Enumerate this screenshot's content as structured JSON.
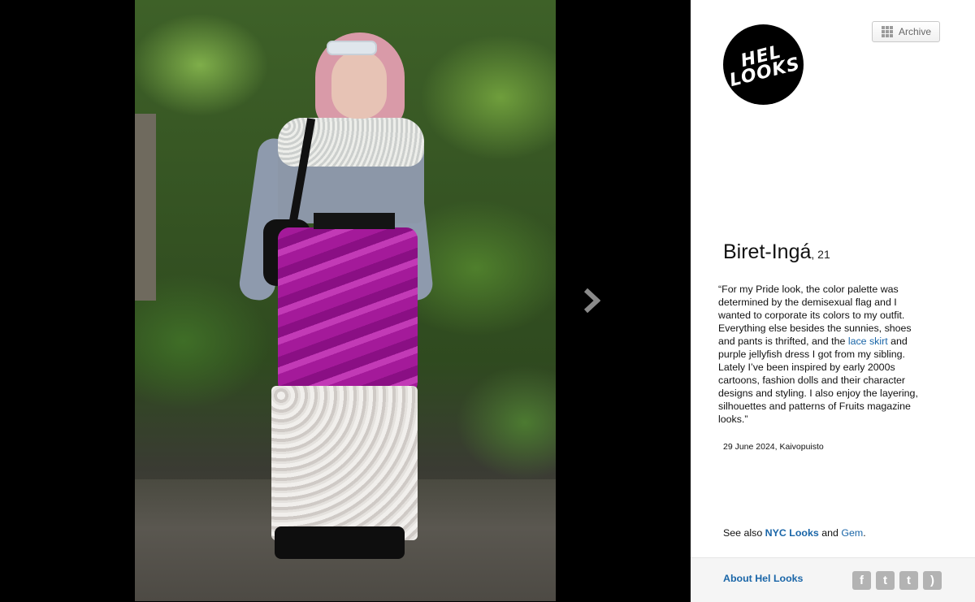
{
  "photo": {
    "alt": ""
  },
  "nav": {
    "next_icon": "chevron-right-icon"
  },
  "header": {
    "logo_line1": "HEL",
    "logo_line2": "LOOKS",
    "archive_label": "Archive",
    "archive_icon": "grid-icon"
  },
  "subject": {
    "name": "Biret-Ingá",
    "age": ", 21"
  },
  "quote": {
    "open": "“For my Pride look, the color palette was determined by the demisexual flag and I wanted to corporate its colors to my outfit. Everything else besides the sunnies, shoes and pants is thrifted, and the ",
    "link_text": "lace skirt",
    "close": " and purple jellyfish dress I got from my sibling. Lately I’ve been inspired by early 2000s cartoons, fashion dolls and their character designs and styling. I also enjoy the layering, silhouettes and patterns of Fruits magazine looks.”"
  },
  "meta": {
    "date_location": "29 June 2024, Kaivopuisto"
  },
  "see_also": {
    "prefix": "See also ",
    "link1": "NYC Looks",
    "and": " and ",
    "link2": "Gem",
    "suffix": "."
  },
  "footer": {
    "about_label": "About Hel Looks",
    "social": [
      {
        "icon": "facebook-icon",
        "glyph": "f"
      },
      {
        "icon": "twitter-icon",
        "glyph": "t"
      },
      {
        "icon": "tumblr-icon",
        "glyph": "t"
      },
      {
        "icon": "rss-icon",
        "glyph": ")"
      }
    ]
  },
  "colors": {
    "link": "#1a66a8",
    "background": "#000000",
    "panel": "#ffffff",
    "icon_gray": "#b3b3b3"
  }
}
